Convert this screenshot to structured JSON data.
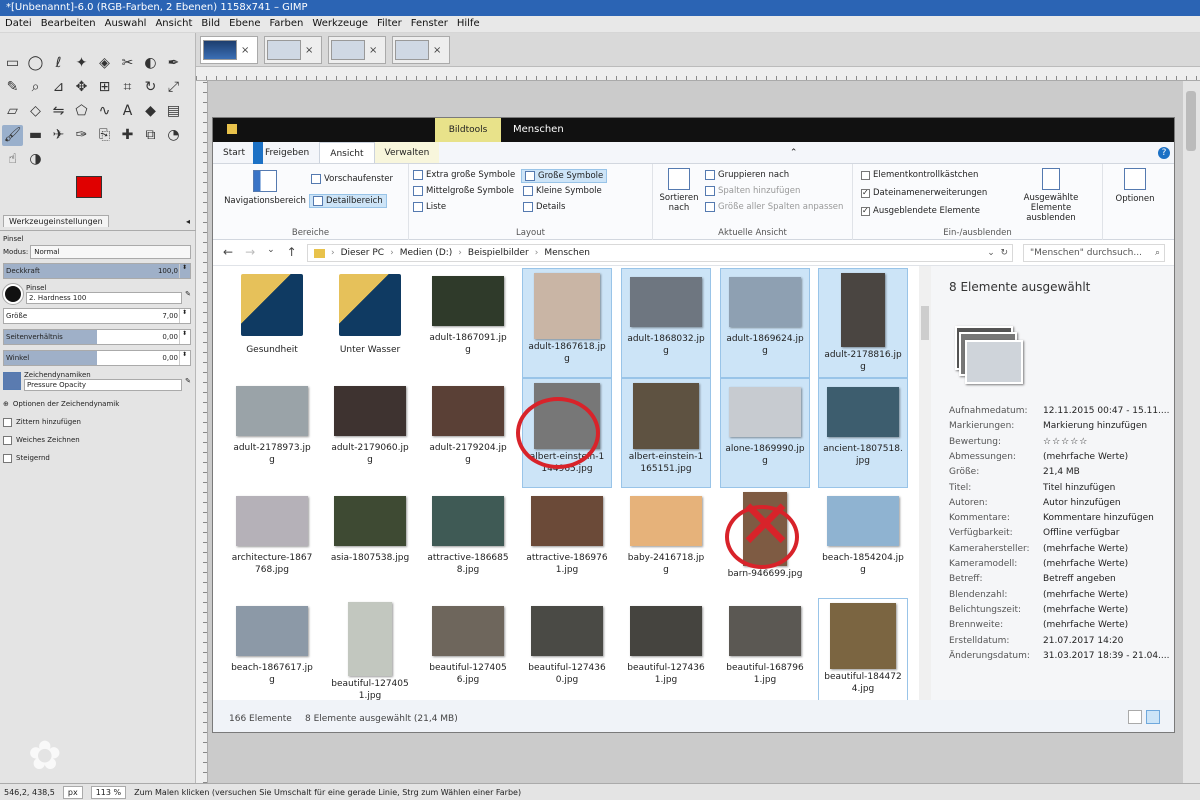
{
  "window": {
    "title": "*[Unbenannt]-6.0 (RGB-Farben, 2 Ebenen) 1158x741 – GIMP"
  },
  "menu": [
    "Datei",
    "Bearbeiten",
    "Auswahl",
    "Ansicht",
    "Bild",
    "Ebene",
    "Farben",
    "Werkzeuge",
    "Filter",
    "Fenster",
    "Hilfe"
  ],
  "image_tabs": [
    {
      "close": "×"
    },
    {
      "close": "×"
    },
    {
      "close": "×"
    },
    {
      "close": "×"
    }
  ],
  "tool_icons": [
    "rect-select-icon",
    "ellipse-select-icon",
    "lasso-icon",
    "fuzzy-select-icon",
    "color-select-icon",
    "scissors-icon",
    "foreground-select-icon",
    "paths-icon",
    "color-picker-icon",
    "zoom-icon",
    "measure-icon",
    "move-icon",
    "align-icon",
    "crop-icon",
    "rotate-icon",
    "scale-icon",
    "shear-icon",
    "perspective-icon",
    "flip-icon",
    "cage-icon",
    "warp-icon",
    "text-icon",
    "bucket-fill-icon",
    "blend-icon",
    "paintbrush-icon",
    "eraser-icon",
    "airbrush-icon",
    "ink-icon",
    "clone-icon",
    "heal-icon",
    "perspective-clone-icon",
    "blur-icon",
    "smudge-icon",
    "dodge-icon"
  ],
  "tool_glyphs": [
    "▭",
    "◯",
    "ℓ",
    "✦",
    "◈",
    "✂",
    "◐",
    "✒",
    "✎",
    "⌕",
    "⊿",
    "✥",
    "⊞",
    "⌗",
    "↻",
    "⤢",
    "▱",
    "◇",
    "⇋",
    "⬠",
    "∿",
    "A",
    "◆",
    "▤",
    "🖌",
    "▬",
    "✈",
    "✑",
    "⎘",
    "✚",
    "⧉",
    "◔",
    "☝",
    "◑"
  ],
  "tool_options": {
    "tab_label": "Werkzeugeinstellungen",
    "tab_button": "◂",
    "tool_name": "Pinsel",
    "mode_label": "Modus:",
    "mode_value": "Normal",
    "opacity_label": "Deckkraft",
    "opacity_value": "100,0",
    "opacity_fill": 1.0,
    "brush_label": "Pinsel",
    "brush_value": "2. Hardness 100",
    "size_label": "Größe",
    "size_value": "7,00",
    "size_fill": 0.0,
    "aspect_label": "Seitenverhältnis",
    "aspect_value": "0,00",
    "aspect_fill": 0.5,
    "angle_label": "Winkel",
    "angle_value": "0,00",
    "angle_fill": 0.5,
    "dynamics_label": "Zeichendynamiken",
    "dynamics_value": "Pressure Opacity",
    "dynamics_options": "Optionen der Zeichendynamik",
    "jitter": "Zittern hinzufügen",
    "smooth": "Weiches Zeichnen",
    "incremental": "Steigernd"
  },
  "status": {
    "coords": "546,2, 438,5",
    "unit": "px",
    "zoom": "113 %",
    "message": "Zum Malen klicken (versuchen Sie Umschalt für eine gerade Linie, Strg zum Wählen einer Farbe)"
  },
  "explorer": {
    "context_tab": "Bildtools",
    "folder_name": "Menschen",
    "tabs": [
      "Start",
      "Freigeben",
      "Ansicht",
      "Verwalten"
    ],
    "ribbon": {
      "nav_pane": "Navigationsbereich",
      "preview_pane": "Vorschaufenster",
      "detail_pane": "Detailbereich",
      "group_panes": "Bereiche",
      "extra_large": "Extra große Symbole",
      "large": "Große Symbole",
      "medium": "Mittelgroße Symbole",
      "small": "Kleine Symbole",
      "list": "Liste",
      "details": "Details",
      "group_layout": "Layout",
      "sort": "Sortieren",
      "sort2": "nach",
      "group_by": "Gruppieren nach",
      "add_cols": "Spalten hinzufügen",
      "fit_cols": "Größe aller Spalten anpassen",
      "group_view": "Aktuelle Ansicht",
      "item_checkboxes": "Elementkontrollkästchen",
      "extensions": "Dateinamenerweiterungen",
      "hidden_items": "Ausgeblendete Elemente",
      "hide_selected": "Ausgewählte",
      "hide_selected2": "Elemente ausblenden",
      "group_showhide": "Ein-/ausblenden",
      "options": "Optionen",
      "item_checkboxes_on": false,
      "extensions_on": true,
      "hidden_items_on": true
    },
    "path": [
      "Dieser PC",
      "Medien (D:)",
      "Beispielbilder",
      "Menschen"
    ],
    "search_placeholder": "\"Menschen\" durchsuch...",
    "files": [
      {
        "name": "Gesundheit",
        "kind": "folder",
        "selected": false
      },
      {
        "name": "Unter Wasser",
        "kind": "folder",
        "selected": false
      },
      {
        "name": "adult-1867091.jpg",
        "kind": "img",
        "color": "#2f3a2a",
        "selected": false
      },
      {
        "name": "adult-1867618.jpg",
        "kind": "img",
        "shape": "sq",
        "color": "#c9b5a5",
        "selected": true
      },
      {
        "name": "adult-1868032.jpg",
        "kind": "img",
        "color": "#6e7680",
        "selected": true
      },
      {
        "name": "adult-1869624.jpg",
        "kind": "img",
        "color": "#8ea0b2",
        "selected": true
      },
      {
        "name": "adult-2178816.jpg",
        "kind": "img",
        "shape": "tall",
        "color": "#4a4541",
        "selected": true
      },
      {
        "name": "adult-2178973.jpg",
        "kind": "img",
        "color": "#9aa3a8",
        "selected": false
      },
      {
        "name": "adult-2179060.jpg",
        "kind": "img",
        "color": "#3e3330",
        "selected": false
      },
      {
        "name": "adult-2179204.jpg",
        "kind": "img",
        "color": "#5a4036",
        "selected": false
      },
      {
        "name": "albert-einstein-1144965.jpg",
        "kind": "img",
        "shape": "sq",
        "color": "#777777",
        "selected": true
      },
      {
        "name": "albert-einstein-1165151.jpg",
        "kind": "img",
        "shape": "sq",
        "color": "#5e5241",
        "selected": true
      },
      {
        "name": "alone-1869990.jpg",
        "kind": "img",
        "color": "#c7cbd0",
        "selected": true
      },
      {
        "name": "ancient-1807518.jpg",
        "kind": "img",
        "color": "#3d5d6e",
        "selected": true
      },
      {
        "name": "architecture-1867768.jpg",
        "kind": "img",
        "color": "#b5b1b8",
        "selected": false
      },
      {
        "name": "asia-1807538.jpg",
        "kind": "img",
        "color": "#3e4a33",
        "selected": false
      },
      {
        "name": "attractive-1866858.jpg",
        "kind": "img",
        "color": "#3f5a55",
        "selected": false
      },
      {
        "name": "attractive-1869761.jpg",
        "kind": "img",
        "color": "#6b4a38",
        "selected": false
      },
      {
        "name": "baby-2416718.jpg",
        "kind": "img",
        "color": "#e6b27a",
        "selected": false
      },
      {
        "name": "barn-946699.jpg",
        "kind": "img",
        "shape": "tall",
        "color": "#7e5b43",
        "selected": false
      },
      {
        "name": "beach-1854204.jpg",
        "kind": "img",
        "color": "#8fb3d1",
        "selected": false
      },
      {
        "name": "beach-1867617.jpg",
        "kind": "img",
        "color": "#8c99a7",
        "selected": false
      },
      {
        "name": "beautiful-1274051.jpg",
        "kind": "img",
        "shape": "tall",
        "color": "#c2c7bf",
        "selected": false
      },
      {
        "name": "beautiful-1274056.jpg",
        "kind": "img",
        "color": "#6e665c",
        "selected": false
      },
      {
        "name": "beautiful-1274360.jpg",
        "kind": "img",
        "color": "#4a4a45",
        "selected": false
      },
      {
        "name": "beautiful-1274361.jpg",
        "kind": "img",
        "color": "#45443f",
        "selected": false
      },
      {
        "name": "beautiful-1687961.jpg",
        "kind": "img",
        "color": "#5b5853",
        "selected": false
      },
      {
        "name": "beautiful-1844724.jpg",
        "kind": "img",
        "shape": "sq",
        "color": "#7b6541",
        "selected": false,
        "focus": true
      }
    ],
    "details_pane": {
      "header": "8 Elemente ausgewählt",
      "props": [
        {
          "k": "Aufnahmedatum:",
          "v": "12.11.2015 00:47 - 15.11...."
        },
        {
          "k": "Markierungen:",
          "v": "Markierung hinzufügen"
        },
        {
          "k": "Bewertung:",
          "v": "☆☆☆☆☆"
        },
        {
          "k": "Abmessungen:",
          "v": "(mehrfache Werte)"
        },
        {
          "k": "Größe:",
          "v": "21,4 MB"
        },
        {
          "k": "Titel:",
          "v": "Titel hinzufügen"
        },
        {
          "k": "Autoren:",
          "v": "Autor hinzufügen"
        },
        {
          "k": "Kommentare:",
          "v": "Kommentare hinzufügen"
        },
        {
          "k": "Verfügbarkeit:",
          "v": "Offline verfügbar"
        },
        {
          "k": "Kamerahersteller:",
          "v": "(mehrfache Werte)"
        },
        {
          "k": "Kameramodell:",
          "v": "(mehrfache Werte)"
        },
        {
          "k": "Betreff:",
          "v": "Betreff angeben"
        },
        {
          "k": "Blendenzahl:",
          "v": "(mehrfache Werte)"
        },
        {
          "k": "Belichtungszeit:",
          "v": "(mehrfache Werte)"
        },
        {
          "k": "Brennweite:",
          "v": "(mehrfache Werte)"
        },
        {
          "k": "Erstelldatum:",
          "v": "21.07.2017 14:20"
        },
        {
          "k": "Änderungsdatum:",
          "v": "31.03.2017 18:39 - 21.04...."
        }
      ]
    },
    "status_count": "166 Elemente",
    "status_selected": "8 Elemente ausgewählt (21,4 MB)"
  },
  "colors": {
    "accent": "#2b64b4",
    "selection": "#cce4f7",
    "annotation": "#d8232a",
    "foreground": "#e00000",
    "background": "#ffffff"
  }
}
